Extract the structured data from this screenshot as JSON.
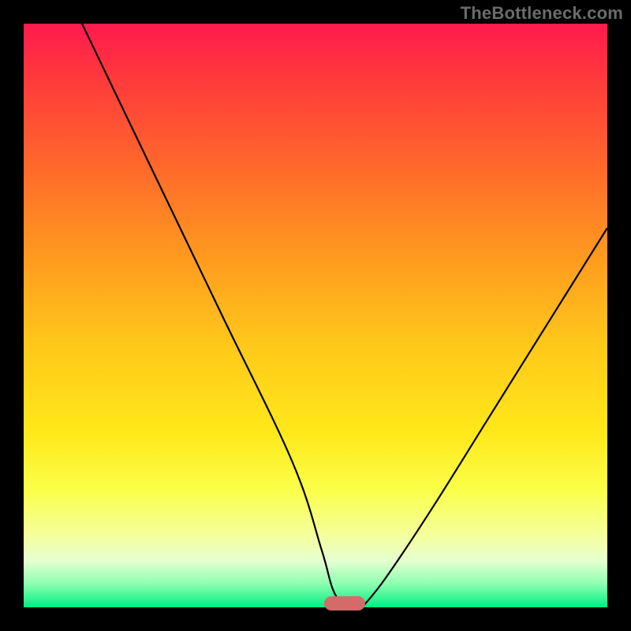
{
  "watermark": "TheBottleneck.com",
  "chart_data": {
    "type": "line",
    "title": "",
    "xlabel": "",
    "ylabel": "",
    "xlim": [
      0,
      100
    ],
    "ylim": [
      0,
      100
    ],
    "grid": false,
    "legend": false,
    "marker": {
      "x": 55,
      "y": 0,
      "width_pct": 7
    },
    "series": [
      {
        "name": "left-branch",
        "x": [
          10,
          22,
          34,
          46,
          51,
          53,
          55
        ],
        "values": [
          100,
          75,
          50,
          25,
          10,
          3,
          0
        ]
      },
      {
        "name": "right-branch",
        "x": [
          58,
          62,
          70,
          80,
          90,
          100
        ],
        "values": [
          0,
          5,
          17,
          33,
          49,
          65
        ]
      }
    ],
    "gradient_stops": [
      {
        "pct": 0,
        "color": "#ff1a4d"
      },
      {
        "pct": 25,
        "color": "#ff6a2a"
      },
      {
        "pct": 55,
        "color": "#ffc81a"
      },
      {
        "pct": 80,
        "color": "#faff4a"
      },
      {
        "pct": 96,
        "color": "#8cffb0"
      },
      {
        "pct": 100,
        "color": "#00ef84"
      }
    ]
  }
}
